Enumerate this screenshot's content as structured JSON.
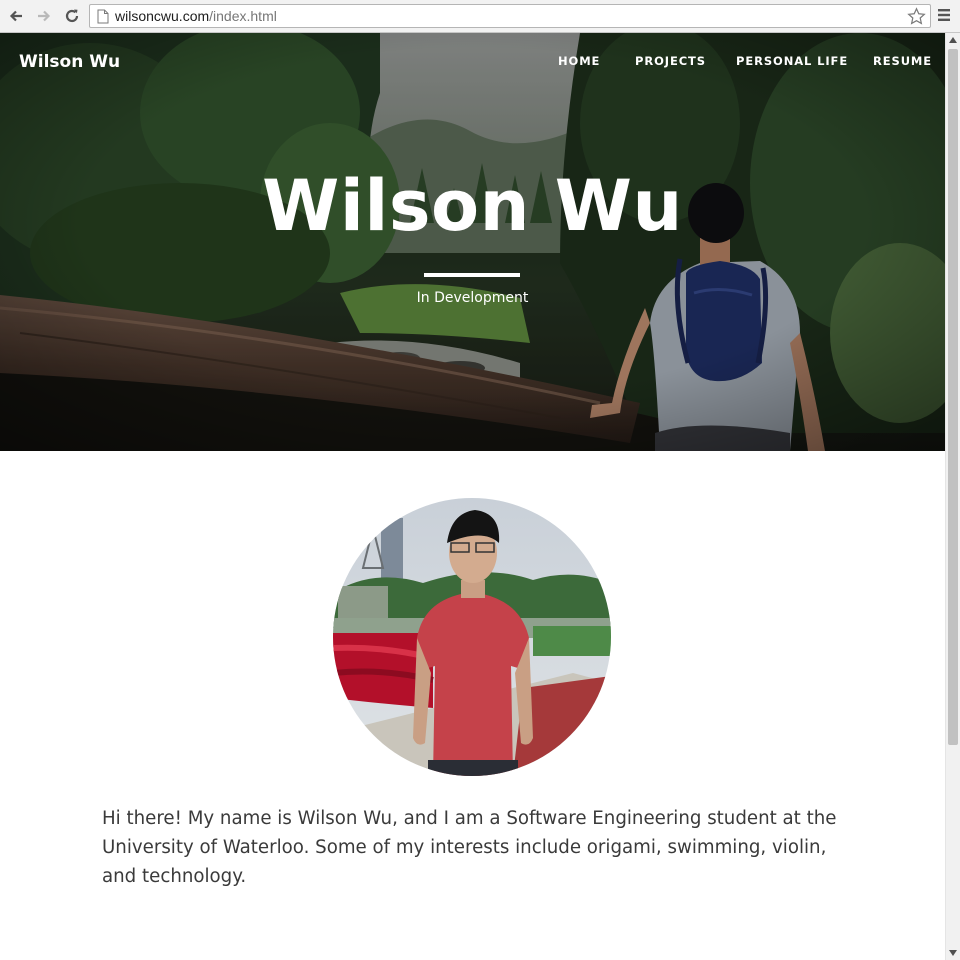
{
  "browser": {
    "url_domain": "wilsoncwu.com",
    "url_path": "/index.html"
  },
  "site": {
    "brand": "Wilson Wu",
    "nav": [
      "HOME",
      "PROJECTS",
      "PERSONAL LIFE",
      "RESUME"
    ]
  },
  "hero": {
    "title": "Wilson Wu",
    "subtitle": "In Development"
  },
  "intro": {
    "text": "Hi there! My name is Wilson Wu, and I am a Software Engineering student at the University of Waterloo. Some of my interests include origami, swimming, violin, and technology."
  },
  "icons": [
    "back-arrow-icon",
    "forward-arrow-icon",
    "reload-icon",
    "page-icon",
    "star-icon",
    "menu-icon",
    "scroll-up-arrow-icon",
    "scroll-down-arrow-icon"
  ]
}
